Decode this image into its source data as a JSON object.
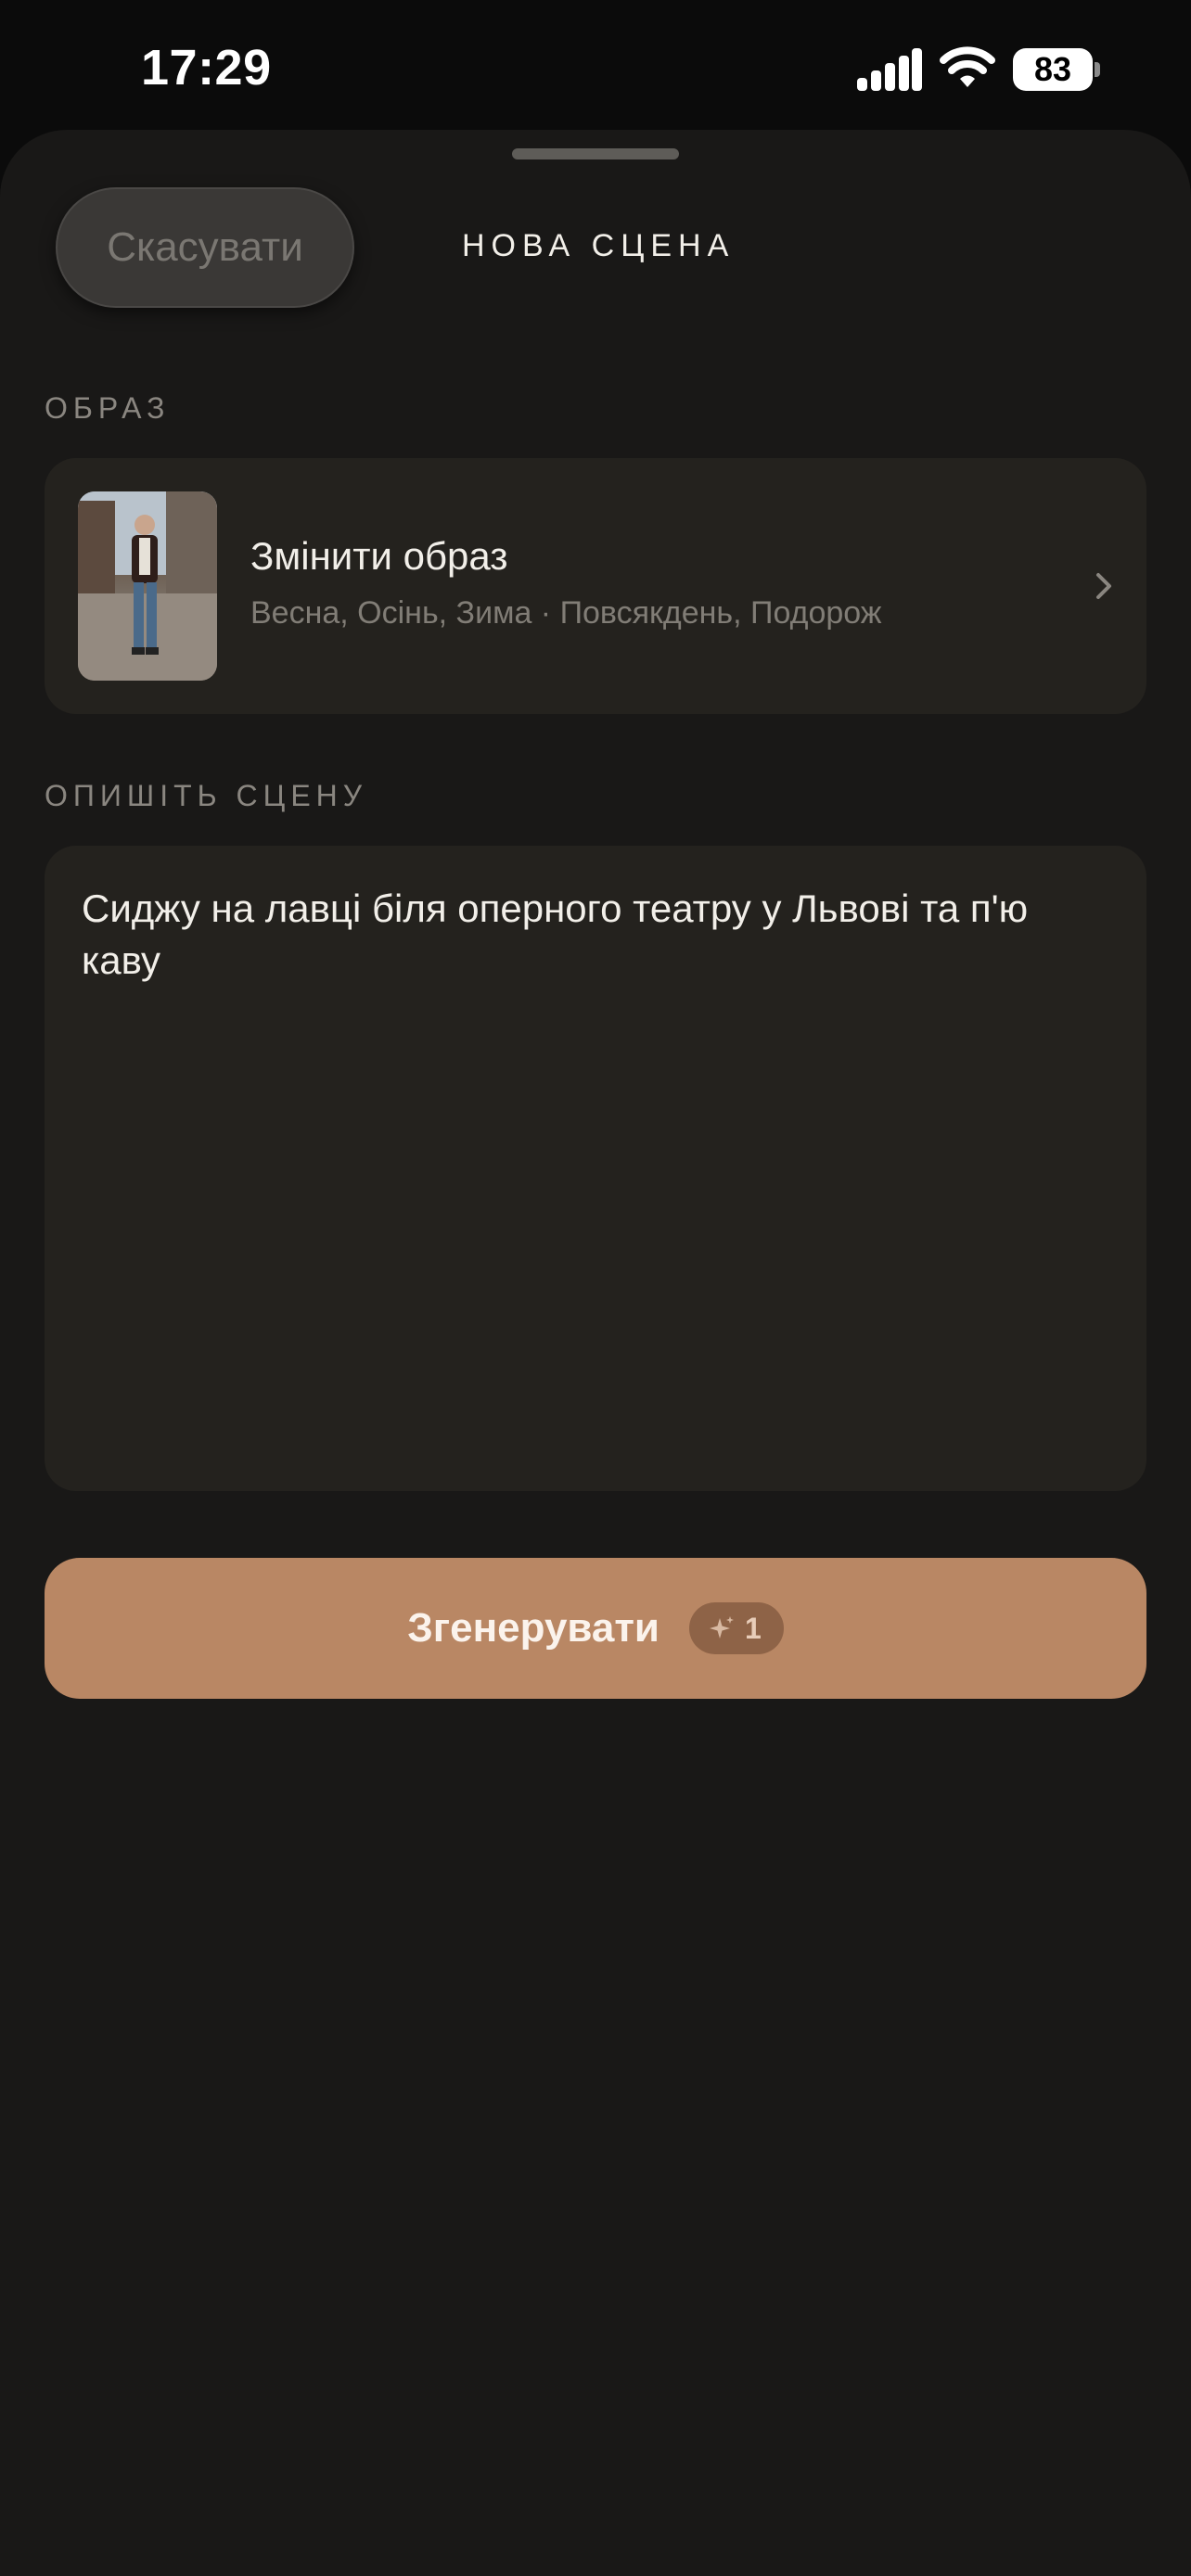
{
  "status_bar": {
    "time": "17:29",
    "battery": "83"
  },
  "header": {
    "cancel_label": "Скасувати",
    "title": "НОВА СЦЕНА"
  },
  "look_section": {
    "label": "ОБРАЗ",
    "card_title": "Змінити образ",
    "card_subtitle": "Весна, Осінь, Зима · Повсякдень, Подорож"
  },
  "scene_section": {
    "label": "ОПИШІТЬ СЦЕНУ",
    "text": "Сиджу на лавці біля оперного театру у Львові та п'ю каву"
  },
  "generate": {
    "label": "Згенерувати",
    "credits": "1"
  },
  "colors": {
    "background": "#191817",
    "card": "#24221e",
    "accent": "#b98764"
  },
  "icons": [
    "signal-icon",
    "wifi-icon",
    "battery-icon",
    "chevron-right-icon",
    "sparkle-icon"
  ]
}
